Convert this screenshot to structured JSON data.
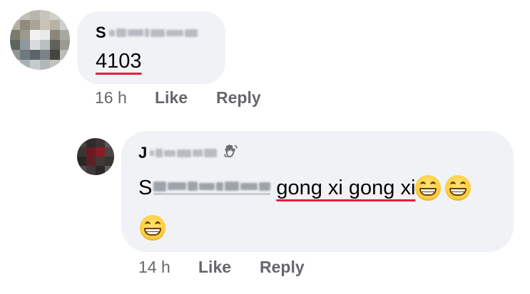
{
  "comments": [
    {
      "author_initial": "S",
      "text": "4103",
      "time": "16 h",
      "like_label": "Like",
      "reply_label": "Reply"
    }
  ],
  "replies": [
    {
      "author_initial": "J",
      "badge_icon": "waving-hand-icon",
      "mention_initial": "S",
      "text": "gong xi gong xi",
      "emojis": [
        "grinning-face",
        "grinning-face",
        "grinning-face"
      ],
      "time": "14 h",
      "like_label": "Like",
      "reply_label": "Reply"
    }
  ],
  "colors": {
    "bubble": "#f0f2f5",
    "meta_text": "#65676b",
    "primary_text": "#050505",
    "spellcheck_underline": "#e41e3f"
  }
}
